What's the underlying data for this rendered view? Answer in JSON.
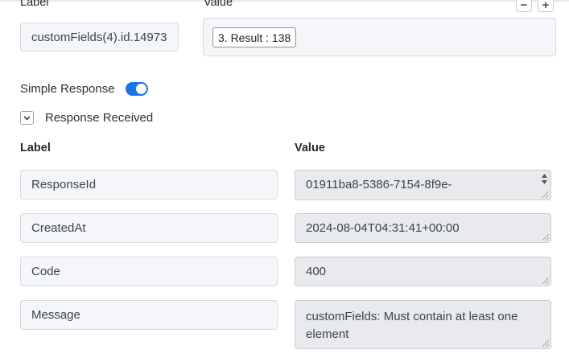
{
  "top_section": {
    "label_header": "Label",
    "value_header": "Value",
    "label_value": "customFields(4).id.14973",
    "result_chip": "3. Result : 138",
    "remove_button": "−",
    "add_button": "+"
  },
  "simple_response": {
    "label": "Simple Response",
    "enabled": true
  },
  "response_received": {
    "label": "Response Received",
    "expanded": true
  },
  "table": {
    "label_header": "Label",
    "value_header": "Value",
    "rows": [
      {
        "label": "ResponseId",
        "value": "01911ba8-5386-7154-8f9e-"
      },
      {
        "label": "CreatedAt",
        "value": "2024-08-04T04:31:41+00:00"
      },
      {
        "label": "Code",
        "value": "400"
      },
      {
        "label": "Message",
        "value": "customFields: Must contain at least one element"
      }
    ]
  },
  "colors": {
    "accent": "#1a73e8",
    "field_background": "#f4f6f9",
    "readonly_background": "#e8eaed"
  }
}
